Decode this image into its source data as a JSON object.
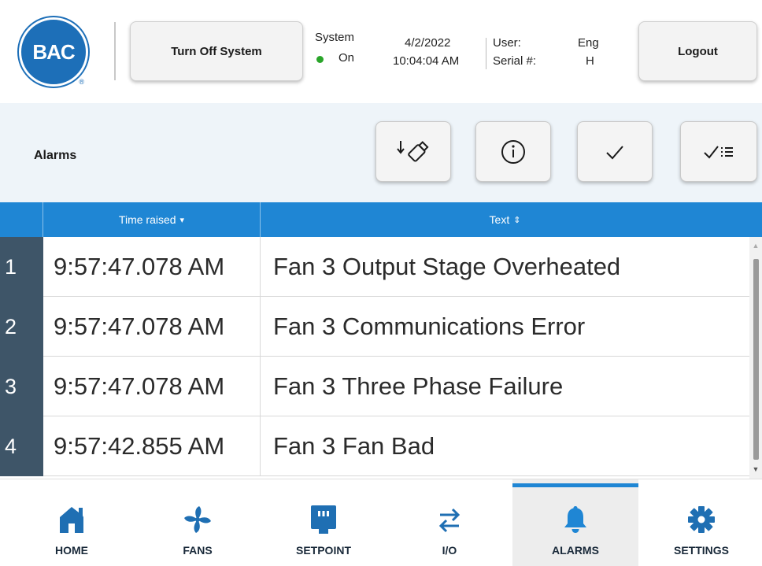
{
  "header": {
    "logo_text": "BAC",
    "turn_off_label": "Turn Off System",
    "system_label": "System",
    "system_state": "On",
    "date": "4/2/2022",
    "time": "10:04:04 AM",
    "user_label": "User:",
    "user_value": "Eng",
    "serial_label": "Serial #:",
    "serial_value": "H",
    "logout_label": "Logout"
  },
  "toolbar": {
    "title": "Alarms",
    "buttons": [
      "export-usb",
      "info",
      "acknowledge",
      "acknowledge-all"
    ]
  },
  "table": {
    "columns": [
      "Time raised",
      "Text"
    ],
    "rows": [
      {
        "num": "1",
        "time": "9:57:47.078 AM",
        "text": "Fan 3 Output Stage Overheated"
      },
      {
        "num": "2",
        "time": "9:57:47.078 AM",
        "text": "Fan 3 Communications Error"
      },
      {
        "num": "3",
        "time": "9:57:47.078 AM",
        "text": "Fan 3 Three Phase Failure"
      },
      {
        "num": "4",
        "time": "9:57:42.855 AM",
        "text": "Fan 3 Fan Bad"
      }
    ]
  },
  "nav": {
    "items": [
      {
        "label": "HOME",
        "icon": "home-icon"
      },
      {
        "label": "FANS",
        "icon": "fan-icon"
      },
      {
        "label": "SETPOINT",
        "icon": "setpoint-icon"
      },
      {
        "label": "I/O",
        "icon": "io-arrows-icon"
      },
      {
        "label": "ALARMS",
        "icon": "bell-icon",
        "active": true
      },
      {
        "label": "SETTINGS",
        "icon": "gear-icon"
      }
    ]
  },
  "colors": {
    "brand_blue": "#1d6fb8",
    "header_blue": "#1f86d4",
    "row_num_bg": "#3e5568",
    "status_on": "#2aa52a",
    "nav_icon": "#1f6fb3"
  }
}
